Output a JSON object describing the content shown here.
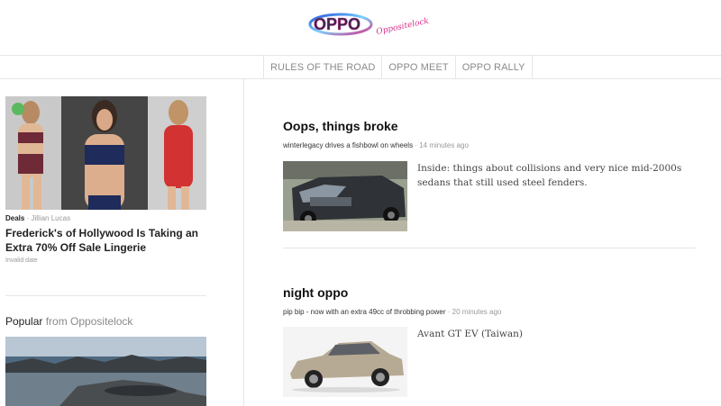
{
  "header": {
    "logo_text": "OPPO",
    "logo_sub": "Oppositelock"
  },
  "nav": {
    "items": [
      {
        "label": "RULES OF THE ROAD"
      },
      {
        "label": "OPPO MEET"
      },
      {
        "label": "OPPO RALLY"
      }
    ]
  },
  "sidebar": {
    "deal": {
      "category": "Deals",
      "author": "Jillian Lucas",
      "title": "Frederick's of Hollywood Is Taking an Extra 70% Off Sale Lingerie",
      "date": "Invalid date"
    },
    "popular": {
      "label": "Popular",
      "from": "from Oppositelock"
    }
  },
  "feed": {
    "posts": [
      {
        "title": "Oops, things broke",
        "author": "winterlegacy drives a fishbowl on wheels",
        "time": "14 minutes ago",
        "excerpt": "Inside: things about collisions and very nice mid-2000s sedans that still used steel fenders."
      },
      {
        "title": "night oppo",
        "author": "pip bip - now with an extra 49cc of throbbing power",
        "time": "20 minutes ago",
        "excerpt": "Avant GT EV (Taiwan)"
      }
    ]
  },
  "colors": {
    "logo_blue": "#2a6fd6",
    "logo_pink": "#d6338a",
    "border": "#e6e6e6",
    "muted": "#999999"
  }
}
